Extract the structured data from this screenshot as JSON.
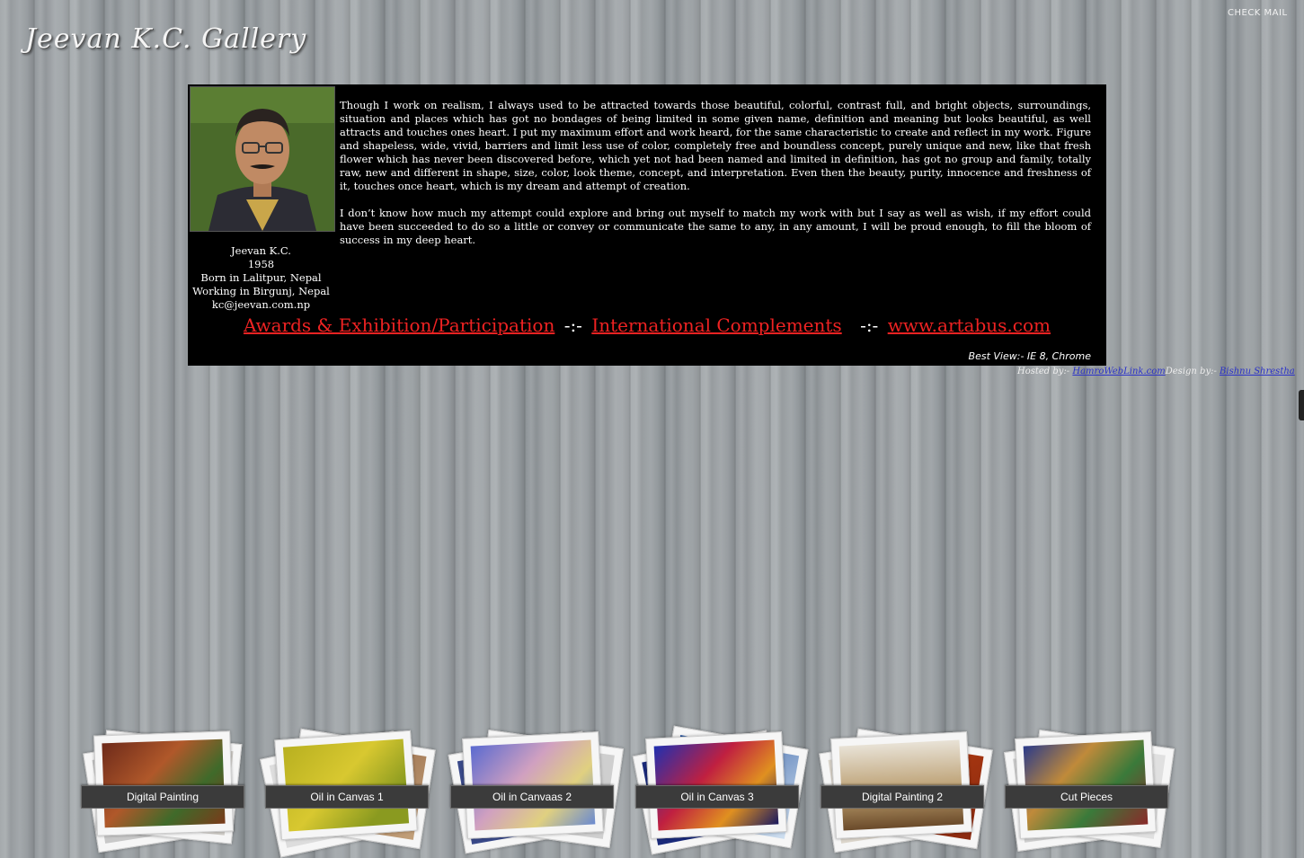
{
  "header": {
    "check_mail": "CHECK MAIL",
    "site_title": "Jeevan K.C. Gallery"
  },
  "artist": {
    "name": "Jeevan K.C.",
    "birth_year": "1958",
    "born": "Born in Lalitpur, Nepal",
    "working": "Working in Birgunj, Nepal",
    "email": "kc@jeevan.com.np"
  },
  "statement": {
    "p1": "Though I work on realism, I always used to be attracted towards those beautiful, colorful, contrast full, and bright objects, surroundings, situation and places which has got no bondages of being limited in some given name, definition and meaning but looks beautiful, as well attracts and touches ones heart. I put my maximum effort and work heard, for the same characteristic to create and reflect in my work. Figure and shapeless, wide, vivid, barriers and limit less use of color, completely free and boundless concept, purely unique and new, like that fresh flower which has never been discovered before, which yet not had been named and limited in definition, has got no group and family, totally raw, new and different in shape, size, color, look theme, concept, and interpretation. Even then the beauty, purity, innocence and freshness of it, touches once heart, which is my dream and attempt of creation.",
    "p2": "I don’t know how much my attempt could explore and bring out myself to match my work with but I say as well as wish, if my effort could have been succeeded to do so a little or convey or communicate the same to any, in any amount, I will be proud enough, to fill the bloom of success in my deep heart."
  },
  "links": {
    "awards": "Awards & Exhibition/Participation",
    "separator": "-:-",
    "international": "International Complements",
    "artabus": "www.artabus.com"
  },
  "best_view": "Best View:- IE 8, Chrome",
  "credits": {
    "hosted_prefix": "Hosted by:- ",
    "host_link": "HamroWebLink.com",
    "design_prefix": "Design by:- ",
    "designer": "Bishnu Shrestha"
  },
  "gallery": {
    "items": [
      {
        "label": "Digital Painting"
      },
      {
        "label": "Oil in Canvas 1"
      },
      {
        "label": "Oil in Canvaas 2"
      },
      {
        "label": "Oil in Canvas 3"
      },
      {
        "label": "Digital Painting 2"
      },
      {
        "label": "Cut Pieces"
      }
    ]
  }
}
